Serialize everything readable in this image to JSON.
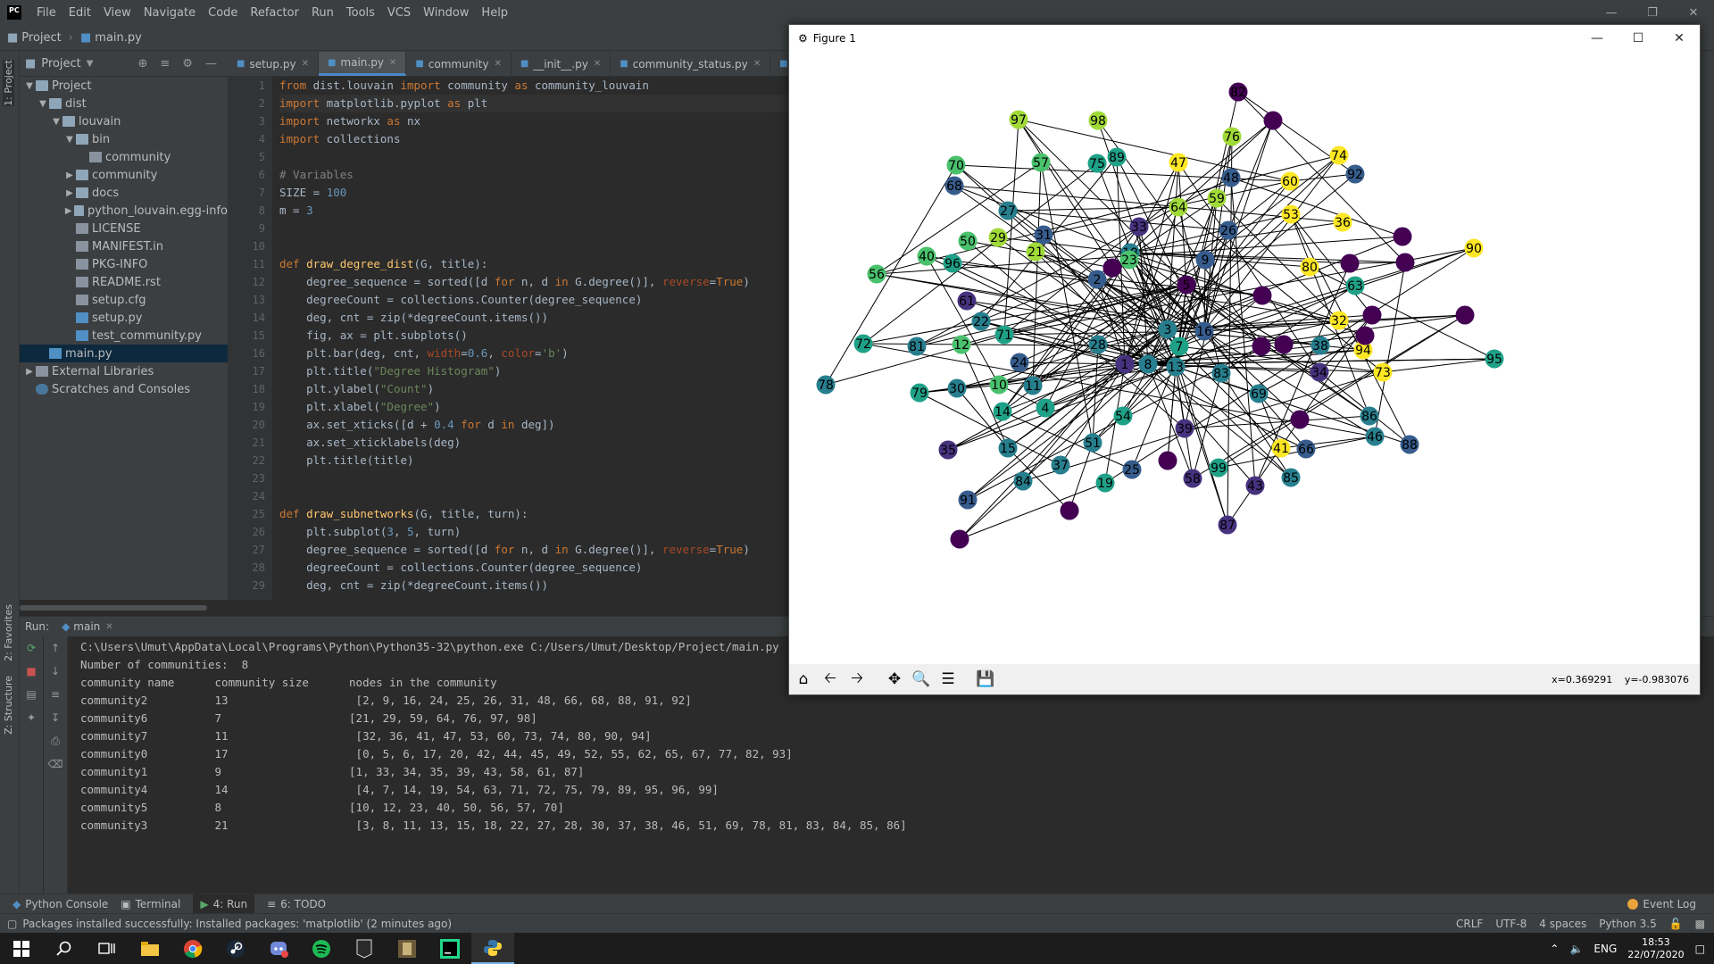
{
  "menubar": {
    "items": [
      "File",
      "Edit",
      "View",
      "Navigate",
      "Code",
      "Refactor",
      "Run",
      "Tools",
      "VCS",
      "Window",
      "Help"
    ]
  },
  "breadcrumb": {
    "project": "Project",
    "file": "main.py"
  },
  "side_tabs": {
    "project": "1: Project",
    "favorites": "2: Favorites",
    "structure": "Z: Structure"
  },
  "project_panel": {
    "title": "Project",
    "tree": [
      {
        "label": "Project",
        "depth": 0,
        "type": "folder",
        "open": true
      },
      {
        "label": "dist",
        "depth": 1,
        "type": "folder",
        "open": true
      },
      {
        "label": "louvain",
        "depth": 2,
        "type": "folder",
        "open": true
      },
      {
        "label": "bin",
        "depth": 3,
        "type": "folder",
        "open": true
      },
      {
        "label": "community",
        "depth": 4,
        "type": "file"
      },
      {
        "label": "community",
        "depth": 3,
        "type": "folder",
        "open": false
      },
      {
        "label": "docs",
        "depth": 3,
        "type": "folder",
        "open": false
      },
      {
        "label": "python_louvain.egg-info",
        "depth": 3,
        "type": "folder",
        "open": false
      },
      {
        "label": "LICENSE",
        "depth": 3,
        "type": "file"
      },
      {
        "label": "MANIFEST.in",
        "depth": 3,
        "type": "file"
      },
      {
        "label": "PKG-INFO",
        "depth": 3,
        "type": "file"
      },
      {
        "label": "README.rst",
        "depth": 3,
        "type": "file"
      },
      {
        "label": "setup.cfg",
        "depth": 3,
        "type": "file"
      },
      {
        "label": "setup.py",
        "depth": 3,
        "type": "py"
      },
      {
        "label": "test_community.py",
        "depth": 3,
        "type": "py"
      },
      {
        "label": "main.py",
        "depth": 1,
        "type": "py",
        "selected": true
      },
      {
        "label": "External Libraries",
        "depth": 0,
        "type": "lib",
        "open": false
      },
      {
        "label": "Scratches and Consoles",
        "depth": 0,
        "type": "scratch"
      }
    ]
  },
  "editor": {
    "tabs": [
      {
        "label": "setup.py",
        "active": false
      },
      {
        "label": "main.py",
        "active": true
      },
      {
        "label": "community",
        "active": false
      },
      {
        "label": "__init__.py",
        "active": false
      },
      {
        "label": "community_status.py",
        "active": false
      },
      {
        "label": "comm",
        "active": false
      }
    ],
    "lines": [
      "from dist.louvain import community as community_louvain",
      "import matplotlib.pyplot as plt",
      "import networkx as nx",
      "import collections",
      "",
      "# Variables",
      "SIZE = 100",
      "m = 3",
      "",
      "",
      "def draw_degree_dist(G, title):",
      "    degree_sequence = sorted([d for n, d in G.degree()], reverse=True)",
      "    degreeCount = collections.Counter(degree_sequence)",
      "    deg, cnt = zip(*degreeCount.items())",
      "    fig, ax = plt.subplots()",
      "    plt.bar(deg, cnt, width=0.6, color='b')",
      "    plt.title(\"Degree Histogram\")",
      "    plt.ylabel(\"Count\")",
      "    plt.xlabel(\"Degree\")",
      "    ax.set_xticks([d + 0.4 for d in deg])",
      "    ax.set_xticklabels(deg)",
      "    plt.title(title)",
      "",
      "",
      "def draw_subnetworks(G, title, turn):",
      "    plt.subplot(3, 5, turn)",
      "    degree_sequence = sorted([d for n, d in G.degree()], reverse=True)",
      "    degreeCount = collections.Counter(degree_sequence)",
      "    deg, cnt = zip(*degreeCount.items())"
    ]
  },
  "run": {
    "label": "Run:",
    "config": "main",
    "output": [
      "C:\\Users\\Umut\\AppData\\Local\\Programs\\Python\\Python35-32\\python.exe C:/Users/Umut/Desktop/Project/main.py",
      "Number of communities:  8",
      "community name      community size      nodes in the community",
      "community2          13                   [2, 9, 16, 24, 25, 26, 31, 48, 66, 68, 88, 91, 92]",
      "community6          7                   [21, 29, 59, 64, 76, 97, 98]",
      "community7          11                   [32, 36, 41, 47, 53, 60, 73, 74, 80, 90, 94]",
      "community0          17                   [0, 5, 6, 17, 20, 42, 44, 45, 49, 52, 55, 62, 65, 67, 77, 82, 93]",
      "community1          9                   [1, 33, 34, 35, 39, 43, 58, 61, 87]",
      "community4          14                   [4, 7, 14, 19, 54, 63, 71, 72, 75, 79, 89, 95, 96, 99]",
      "community5          8                   [10, 12, 23, 40, 50, 56, 57, 70]",
      "community3          21                   [3, 8, 11, 13, 15, 18, 22, 27, 28, 30, 37, 38, 46, 51, 69, 78, 81, 83, 84, 85, 86]"
    ]
  },
  "bottom_tabs": [
    "Python Console",
    "Terminal",
    "4: Run",
    "6: TODO"
  ],
  "event_log": "Event Log",
  "status": {
    "message": "Packages installed successfully: Installed packages: 'matplotlib' (2 minutes ago)",
    "line_sep": "CRLF",
    "encoding": "UTF-8",
    "indent": "4 spaces",
    "interpreter": "Python 3.5"
  },
  "figure": {
    "title": "Figure 1",
    "coords": {
      "x": "x=0.369291",
      "y": "y=-0.983076"
    },
    "community_colors": {
      "c0": "#440154",
      "c1": "#46327e",
      "c2": "#365c8d",
      "c3": "#277f8e",
      "c4": "#1fa187",
      "c5": "#4ac16d",
      "c6": "#a0da39",
      "c7": "#fde725"
    },
    "nodes": [
      {
        "id": "82",
        "c": "c0"
      },
      {
        "id": "",
        "c": "c0"
      },
      {
        "id": "97",
        "c": "c6"
      },
      {
        "id": "98",
        "c": "c6"
      },
      {
        "id": "76",
        "c": "c6"
      },
      {
        "id": "74",
        "c": "c7"
      },
      {
        "id": "47",
        "c": "c7"
      },
      {
        "id": "89",
        "c": "c4"
      },
      {
        "id": "70",
        "c": "c5"
      },
      {
        "id": "57",
        "c": "c5"
      },
      {
        "id": "75",
        "c": "c4"
      },
      {
        "id": "92",
        "c": "c2"
      },
      {
        "id": "48",
        "c": "c2"
      },
      {
        "id": "60",
        "c": "c7"
      },
      {
        "id": "68",
        "c": "c2"
      },
      {
        "id": "59",
        "c": "c6"
      },
      {
        "id": "64",
        "c": "c6"
      },
      {
        "id": "53",
        "c": "c7"
      },
      {
        "id": "27",
        "c": "c3"
      },
      {
        "id": "36",
        "c": "c7"
      },
      {
        "id": "33",
        "c": "c1"
      },
      {
        "id": "31",
        "c": "c2"
      },
      {
        "id": "26",
        "c": "c2"
      },
      {
        "id": "29",
        "c": "c6"
      },
      {
        "id": "50",
        "c": "c5"
      },
      {
        "id": "21",
        "c": "c6"
      },
      {
        "id": "18",
        "c": "c3"
      },
      {
        "id": "23",
        "c": "c5"
      },
      {
        "id": "9",
        "c": "c2"
      },
      {
        "id": "90",
        "c": "c7"
      },
      {
        "id": "40",
        "c": "c5"
      },
      {
        "id": "96",
        "c": "c4"
      },
      {
        "id": "56",
        "c": "c5"
      },
      {
        "id": "",
        "c": "c0"
      },
      {
        "id": "2",
        "c": "c2"
      },
      {
        "id": "5",
        "c": "c0"
      },
      {
        "id": "80",
        "c": "c7"
      },
      {
        "id": "63",
        "c": "c4"
      },
      {
        "id": "61",
        "c": "c1"
      },
      {
        "id": "",
        "c": "c0"
      },
      {
        "id": "22",
        "c": "c3"
      },
      {
        "id": "71",
        "c": "c4"
      },
      {
        "id": "3",
        "c": "c3"
      },
      {
        "id": "16",
        "c": "c2"
      },
      {
        "id": "32",
        "c": "c7"
      },
      {
        "id": "72",
        "c": "c4"
      },
      {
        "id": "81",
        "c": "c3"
      },
      {
        "id": "12",
        "c": "c5"
      },
      {
        "id": "28",
        "c": "c3"
      },
      {
        "id": "7",
        "c": "c4"
      },
      {
        "id": "38",
        "c": "c3"
      },
      {
        "id": "94",
        "c": "c7"
      },
      {
        "id": "24",
        "c": "c2"
      },
      {
        "id": "1",
        "c": "c1"
      },
      {
        "id": "8",
        "c": "c3"
      },
      {
        "id": "13",
        "c": "c3"
      },
      {
        "id": "83",
        "c": "c3"
      },
      {
        "id": "34",
        "c": "c1"
      },
      {
        "id": "73",
        "c": "c7"
      },
      {
        "id": "95",
        "c": "c4"
      },
      {
        "id": "78",
        "c": "c3"
      },
      {
        "id": "79",
        "c": "c4"
      },
      {
        "id": "30",
        "c": "c3"
      },
      {
        "id": "10",
        "c": "c5"
      },
      {
        "id": "11",
        "c": "c3"
      },
      {
        "id": "69",
        "c": "c3"
      },
      {
        "id": "14",
        "c": "c4"
      },
      {
        "id": "4",
        "c": "c4"
      },
      {
        "id": "54",
        "c": "c4"
      },
      {
        "id": "86",
        "c": "c3"
      },
      {
        "id": "46",
        "c": "c3"
      },
      {
        "id": "39",
        "c": "c1"
      },
      {
        "id": "88",
        "c": "c2"
      },
      {
        "id": "35",
        "c": "c1"
      },
      {
        "id": "15",
        "c": "c3"
      },
      {
        "id": "51",
        "c": "c3"
      },
      {
        "id": "41",
        "c": "c7"
      },
      {
        "id": "66",
        "c": "c2"
      },
      {
        "id": "37",
        "c": "c3"
      },
      {
        "id": "",
        "c": "c0"
      },
      {
        "id": "99",
        "c": "c4"
      },
      {
        "id": "25",
        "c": "c2"
      },
      {
        "id": "84",
        "c": "c3"
      },
      {
        "id": "19",
        "c": "c4"
      },
      {
        "id": "58",
        "c": "c1"
      },
      {
        "id": "43",
        "c": "c1"
      },
      {
        "id": "85",
        "c": "c3"
      },
      {
        "id": "",
        "c": "c0"
      },
      {
        "id": "87",
        "c": "c1"
      },
      {
        "id": "",
        "c": "c0"
      },
      {
        "id": "91",
        "c": "c2"
      },
      {
        "id": "",
        "c": "c0"
      },
      {
        "id": "",
        "c": "c0"
      },
      {
        "id": "",
        "c": "c0"
      },
      {
        "id": "",
        "c": "c0"
      },
      {
        "id": "",
        "c": "c0"
      },
      {
        "id": "",
        "c": "c0"
      },
      {
        "id": "",
        "c": "c0"
      },
      {
        "id": "",
        "c": "c0"
      },
      {
        "id": "",
        "c": "c0"
      },
      {
        "id": "",
        "c": "c0"
      },
      {
        "id": "",
        "c": "c0"
      },
      {
        "id": "",
        "c": "c0"
      }
    ]
  },
  "taskbar": {
    "lang": "ENG",
    "time": "18:53",
    "date": "22/07/2020"
  }
}
